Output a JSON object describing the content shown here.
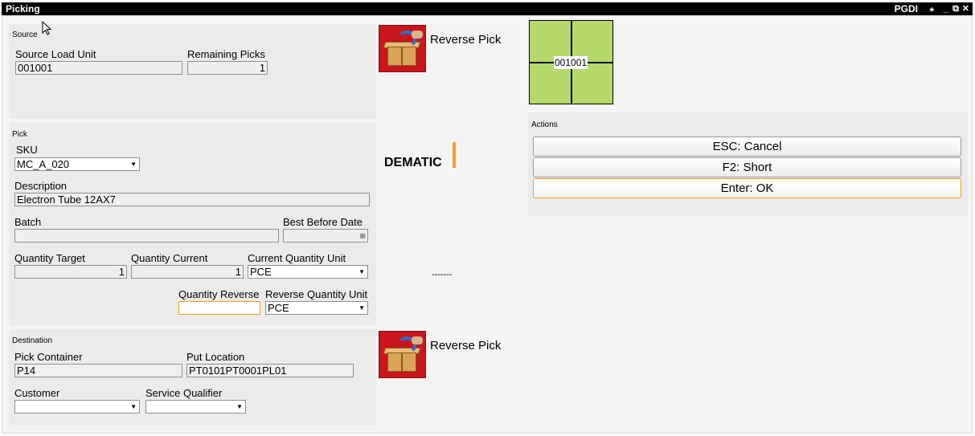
{
  "window": {
    "title": "Picking",
    "app_name": "PGDI",
    "controls": {
      "pin": "⁎",
      "minimize": "_",
      "restore": "⧉",
      "close": "✕"
    }
  },
  "source": {
    "title": "Source",
    "load_unit_label": "Source Load Unit",
    "load_unit_value": "001001",
    "remaining_label": "Remaining Picks",
    "remaining_value": "1"
  },
  "pick": {
    "title": "Pick",
    "sku_label": "SKU",
    "sku_value": "MC_A_020",
    "description_label": "Description",
    "description_value": "Electron Tube 12AX7",
    "batch_label": "Batch",
    "batch_value": "",
    "best_before_label": "Best Before Date",
    "best_before_value": "",
    "qty_target_label": "Quantity Target",
    "qty_target_value": "1",
    "qty_current_label": "Quantity Current",
    "qty_current_value": "1",
    "current_unit_label": "Current Quantity Unit",
    "current_unit_value": "PCE",
    "qty_reverse_label": "Quantity Reverse",
    "qty_reverse_value": "",
    "reverse_unit_label": "Reverse Quantity Unit",
    "reverse_unit_value": "PCE"
  },
  "destination": {
    "title": "Destination",
    "container_label": "Pick Container",
    "container_value": "P14",
    "put_location_label": "Put Location",
    "put_location_value": "PT0101PT0001PL01",
    "customer_label": "Customer",
    "customer_value": "",
    "service_label": "Service Qualifier",
    "service_value": ""
  },
  "center": {
    "reverse_pick_label_top": "Reverse Pick",
    "reverse_pick_label_bottom": "Reverse Pick",
    "brand": "DEMATIC",
    "brand_color": "#f3a21b",
    "dashes": "-------",
    "pick_icon": "reverse-pick-box-icon"
  },
  "location_tile": {
    "label": "001001",
    "fill_color": "#b5d96a"
  },
  "actions": {
    "title": "Actions",
    "cancel_label": "ESC: Cancel",
    "short_label": "F2: Short",
    "ok_label": "Enter: OK"
  }
}
